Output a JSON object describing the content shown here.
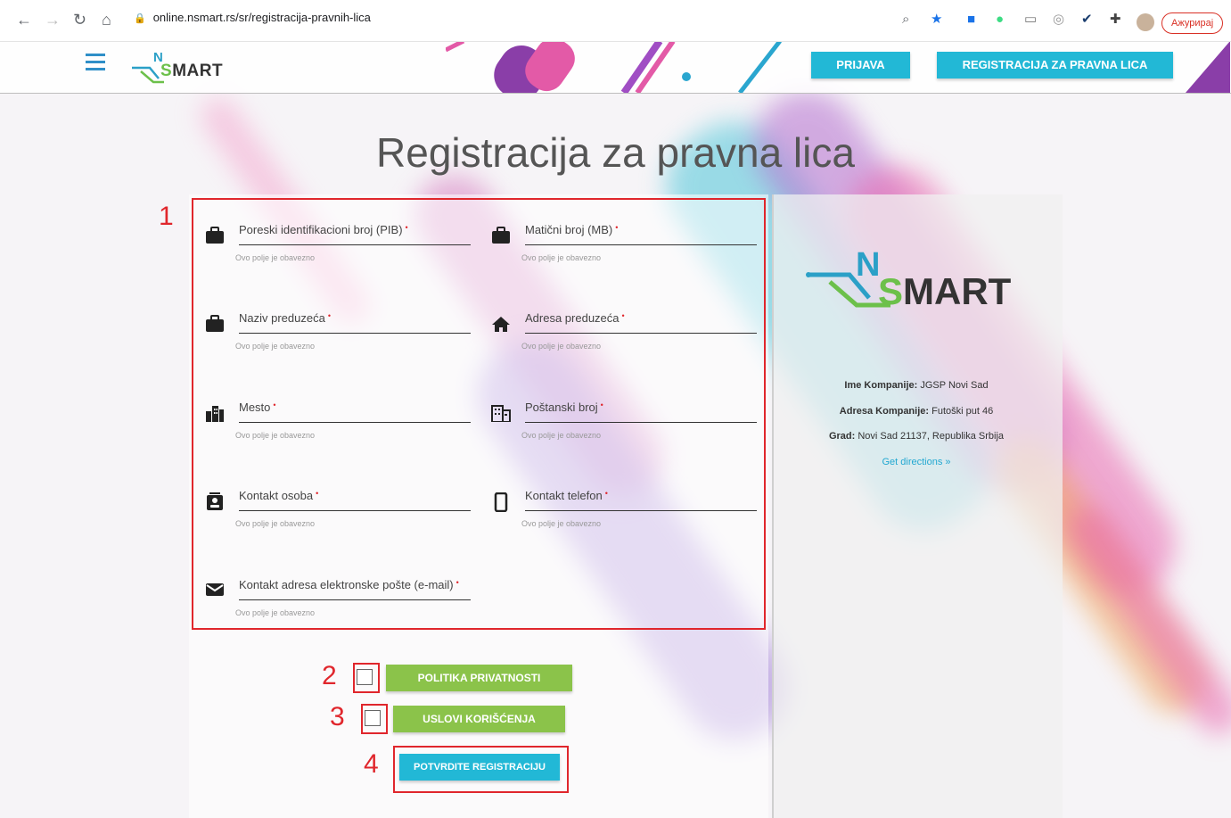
{
  "browser": {
    "url": "online.nsmart.rs/sr/registracija-pravnih-lica",
    "update_label": "Ажурирај"
  },
  "header": {
    "logo_n": "N",
    "logo_s": "S",
    "logo_mart": "MART",
    "login_label": "PRIJAVA",
    "register_label": "REGISTRACIJA ZA PRAVNA LICA"
  },
  "page": {
    "title": "Registracija za pravna lica"
  },
  "form": {
    "hint": "Ovo polje je obavezno",
    "required_mark": "•",
    "fields": [
      {
        "label": "Poreski identifikacioni broj (PIB)",
        "icon": "briefcase-icon"
      },
      {
        "label": "Matični broj (MB)",
        "icon": "briefcase-icon"
      },
      {
        "label": "Naziv preduzeća",
        "icon": "briefcase-icon"
      },
      {
        "label": "Adresa preduzeća",
        "icon": "home-icon"
      },
      {
        "label": "Mesto",
        "icon": "city-icon"
      },
      {
        "label": "Poštanski broj",
        "icon": "building-icon"
      },
      {
        "label": "Kontakt osoba",
        "icon": "contact-card-icon"
      },
      {
        "label": "Kontakt telefon",
        "icon": "phone-icon"
      },
      {
        "label": "Kontakt adresa elektronske pošte (e-mail)",
        "icon": "mail-icon"
      }
    ],
    "privacy_label": "POLITIKA PRIVATNOSTI",
    "terms_label": "USLOVI KORIŠĆENJA",
    "confirm_label": "POTVRDITE REGISTRACIJU"
  },
  "annotations": [
    "1",
    "2",
    "3",
    "4"
  ],
  "info": {
    "logo_n": "N",
    "logo_s": "S",
    "logo_mart": "MART",
    "company_label": "Ime Kompanije:",
    "company_value": "JGSP Novi Sad",
    "address_label": "Adresa Kompanije:",
    "address_value": "Futoški put 46",
    "city_label": "Grad:",
    "city_value": "Novi Sad 21137, Republika Srbija",
    "directions_label": "Get directions »"
  },
  "colors": {
    "accent": "#22b8d6",
    "green": "#8bc34a",
    "annotation": "#e0262c"
  }
}
